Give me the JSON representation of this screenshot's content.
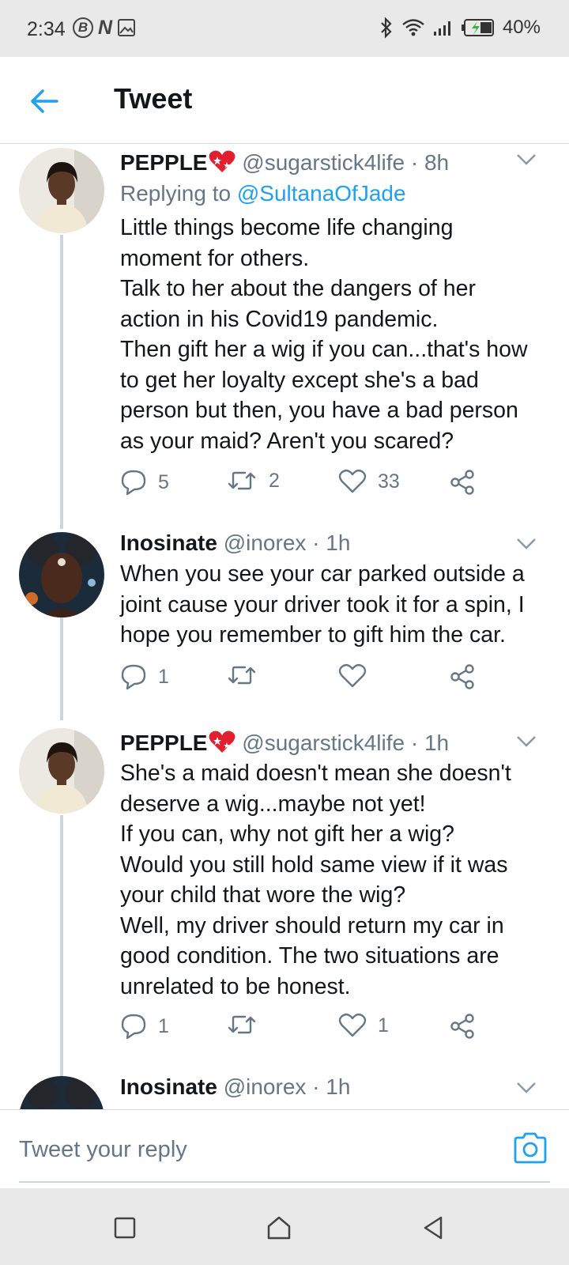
{
  "status_bar": {
    "time": "2:34",
    "battery": "40%",
    "icons": [
      "b-circle-icon",
      "n-icon",
      "gallery-icon",
      "bluetooth-icon",
      "wifi-icon",
      "signal-icon",
      "battery-charging-icon"
    ]
  },
  "header": {
    "title": "Tweet",
    "back_icon": "arrow-left-icon"
  },
  "colors": {
    "accent": "#1da1f2",
    "muted": "#657786",
    "thread_line": "#ccd6dd"
  },
  "tweets": [
    {
      "name": "PEPPLE",
      "meta": "@sugarstick4life · 8h",
      "reply_prefix": "Replying to ",
      "reply_handle": "@SultanaOfJade",
      "text": "Little things become life changing\nmoment for others.\nTalk to her about the dangers of her\naction in his Covid19 pandemic.\nThen gift her a wig if you can...that's how\nto get her loyalty except she's a bad\nperson but then, you have a bad person\nas your maid? Aren't you scared?",
      "replies": "5",
      "retweets": "2",
      "likes": "33"
    },
    {
      "name": "Inosinate",
      "meta": "@inorex · 1h",
      "text": "When you see your car parked outside a\njoint cause your driver took it for a spin, I\nhope you remember to gift him the car.",
      "replies": "1",
      "retweets": "",
      "likes": ""
    },
    {
      "name": "PEPPLE",
      "meta": "@sugarstick4life · 1h",
      "text": "She's a maid doesn't mean she doesn't\ndeserve a wig...maybe not yet!\nIf you can, why not gift her a wig?\nWould you still hold same view if it was\nyour child that wore the wig?\nWell, my driver should return my car in\ngood condition. The two situations are\nunrelated to be honest.",
      "replies": "1",
      "retweets": "",
      "likes": "1"
    },
    {
      "name": "Inosinate",
      "meta": "@inorex · 1h"
    }
  ],
  "reply_bar": {
    "placeholder": "Tweet your reply"
  },
  "nav_bar": {
    "buttons": [
      "recents-square-icon",
      "home-icon",
      "back-triangle-icon"
    ]
  }
}
